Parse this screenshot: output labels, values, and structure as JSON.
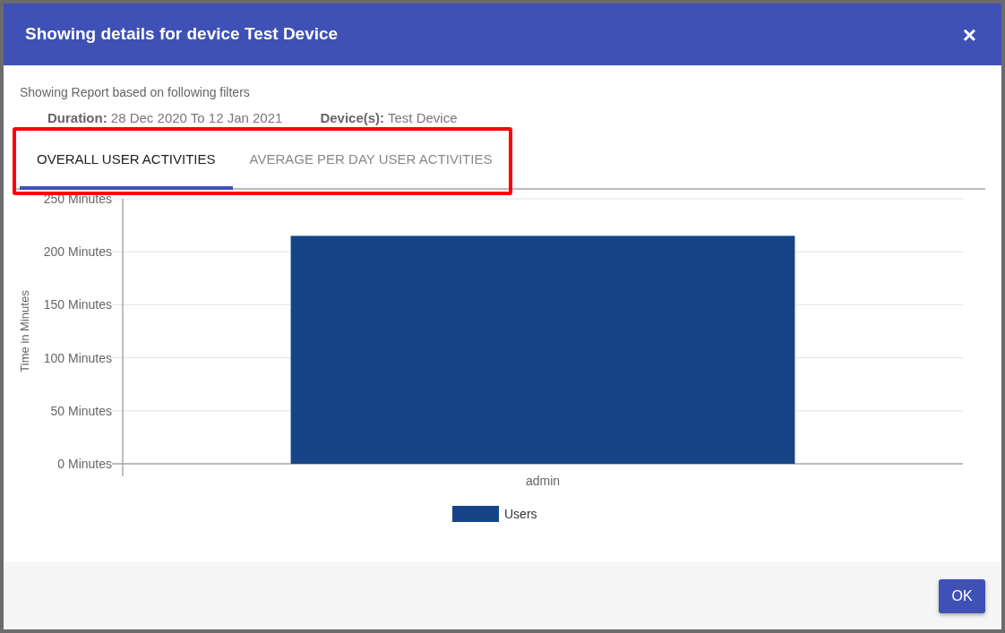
{
  "dialog": {
    "title": "Showing details for device Test Device",
    "close": "×"
  },
  "filters": {
    "heading": "Showing Report based on following filters",
    "items": [
      {
        "label": "Duration:",
        "value": "28 Dec 2020 To 12 Jan 2021"
      },
      {
        "label": "Device(s):",
        "value": "Test Device"
      }
    ]
  },
  "tabs": {
    "highlighted": true,
    "items": [
      {
        "label": "OVERALL USER ACTIVITIES",
        "selected": true
      },
      {
        "label": "AVERAGE PER DAY USER ACTIVITIES",
        "selected": false
      }
    ]
  },
  "chart": {
    "chart_data": {
      "type": "bar",
      "grid": true,
      "ylabel": "Time in Minutes",
      "categories": [
        "admin"
      ],
      "series": [
        {
          "name": "Users",
          "color": "#174486",
          "values": [
            215
          ]
        }
      ],
      "ylim": [
        0,
        250
      ],
      "yticks": [
        {
          "value": 0,
          "label": "0 Minutes"
        },
        {
          "value": 50,
          "label": "50 Minutes"
        },
        {
          "value": 100,
          "label": "100 Minutes"
        },
        {
          "value": 150,
          "label": "150 Minutes"
        },
        {
          "value": 200,
          "label": "200 Minutes"
        },
        {
          "value": 250,
          "label": "250 Minutes"
        }
      ]
    }
  },
  "buttons": [
    "OK"
  ]
}
